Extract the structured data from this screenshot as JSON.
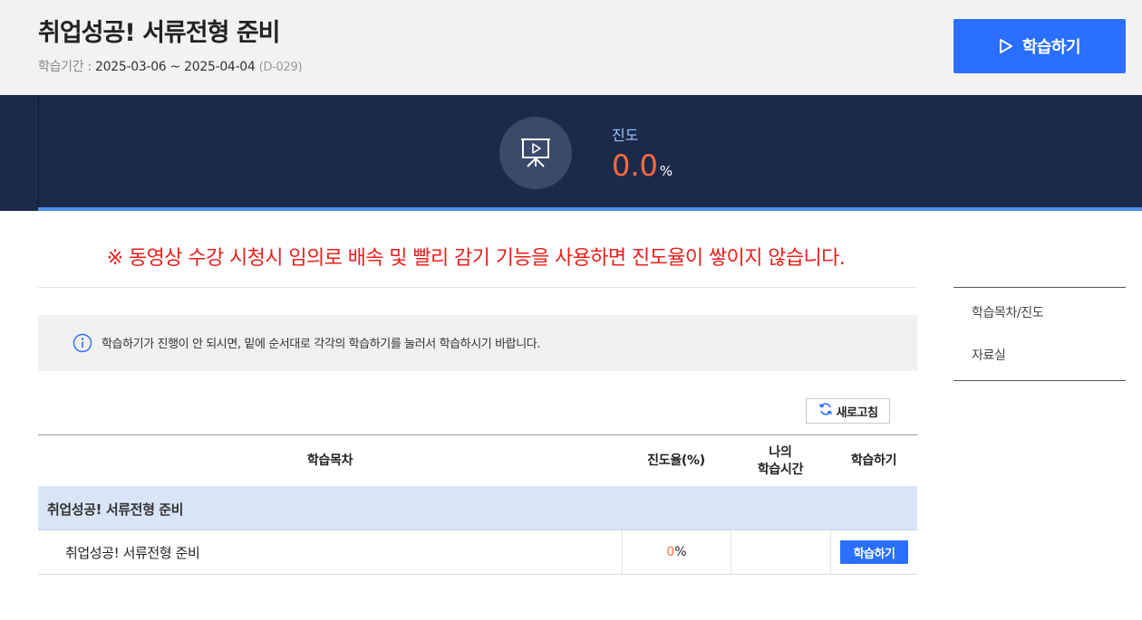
{
  "header": {
    "title": "취업성공! 서류전형 준비",
    "period_label": "학습기간 : ",
    "period_dates": "2025-03-06 ~ 2025-04-04",
    "dday": "(D-029)",
    "start_button": "학습하기"
  },
  "progress": {
    "icon": "presentation-play-icon",
    "label": "진도",
    "value": "0.0",
    "unit": "%",
    "fraction": 0.0
  },
  "warning": "※ 동영상 수강 시청시 임의로 배속 및 빨리 감기 기능을 사용하면 진도율이 쌓이지 않습니다.",
  "notice": {
    "icon": "info-icon",
    "text": "학습하기가 진행이 안 되시면, 밑에 순서대로 각각의 학습하기를 눌러서 학습하시기 바랍니다."
  },
  "refresh_button": "새로고침",
  "table": {
    "headers": {
      "title": "학습목차",
      "progress": "진도율(%)",
      "time_line1": "나의",
      "time_line2": "학습시간",
      "action": "학습하기"
    },
    "group": "취업성공! 서류전형 준비",
    "rows": [
      {
        "title": "취업성공! 서류전형 준비",
        "progress": "0",
        "unit": "%",
        "time": "",
        "button": "학습하기"
      }
    ]
  },
  "side_menu": {
    "items": [
      {
        "label": "학습목차/진도"
      },
      {
        "label": "자료실"
      }
    ]
  },
  "colors": {
    "accent": "#2a6fff",
    "banner_bg": "#1c2a4a",
    "warning": "#e8201b",
    "progress_value": "#ff6b3d"
  }
}
